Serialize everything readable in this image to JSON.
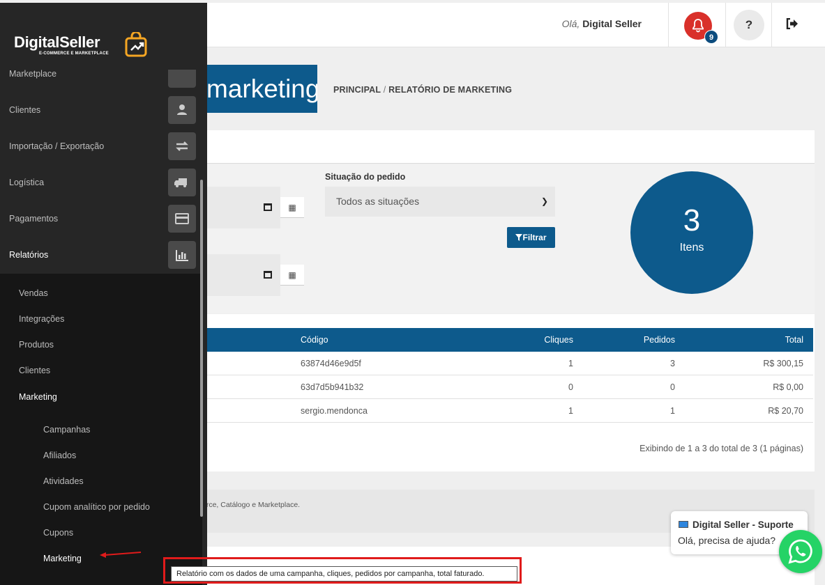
{
  "header": {
    "greeting_prefix": "Olá,",
    "user_name": "Digital Seller",
    "notification_count": "9",
    "help_label": "?"
  },
  "page": {
    "title": "marketing",
    "breadcrumb_home": "PRINCIPAL",
    "breadcrumb_sep": "/",
    "breadcrumb_current": "RELATÓRIO DE MARKETING"
  },
  "filters": {
    "situation_label": "Situação do pedido",
    "situation_value": "Todos as situações",
    "filter_button": "Filtrar"
  },
  "summary": {
    "count": "3",
    "label": "Itens"
  },
  "table": {
    "headers": {
      "code": "Código",
      "clicks": "Cliques",
      "orders": "Pedidos",
      "total": "Total"
    },
    "rows": [
      {
        "code": "63874d46e9d5f",
        "clicks": "1",
        "orders": "3",
        "total": "R$ 300,15"
      },
      {
        "code": "63d7d5b941b32",
        "clicks": "0",
        "orders": "0",
        "total": "R$ 0,00"
      },
      {
        "code": "sergio.mendonca",
        "clicks": "1",
        "orders": "1",
        "total": "R$ 20,70"
      }
    ],
    "pager_info": "Exibindo de 1 a 3 do total de 3 (1 páginas)"
  },
  "footer": {
    "text": "erce, Catálogo e Marketplace."
  },
  "sidebar": {
    "brand": "DigitalSeller",
    "brand_sub": "E-COMMERCE E MARKETPLACE",
    "items": [
      {
        "label": "Marketplace"
      },
      {
        "label": "Clientes"
      },
      {
        "label": "Importação / Exportação"
      },
      {
        "label": "Logística"
      },
      {
        "label": "Pagamentos"
      },
      {
        "label": "Relatórios"
      }
    ],
    "reports_sub": [
      "Vendas",
      "Integrações",
      "Produtos",
      "Clientes",
      "Marketing"
    ],
    "marketing_sub": [
      "Campanhas",
      "Afiliados",
      "Atividades",
      "Cupom analítico por pedido",
      "Cupons",
      "Marketing"
    ]
  },
  "tooltip": "Relatório com os dados de uma campanha, cliques, pedidos por campanha, total faturado.",
  "chat": {
    "title": "Digital Seller - Suporte",
    "message": "Olá, precisa de ajuda?"
  },
  "colors": {
    "primary": "#0d5a8c",
    "sidebar": "#262626",
    "notification": "#d9302a",
    "whatsapp": "#25d366"
  }
}
